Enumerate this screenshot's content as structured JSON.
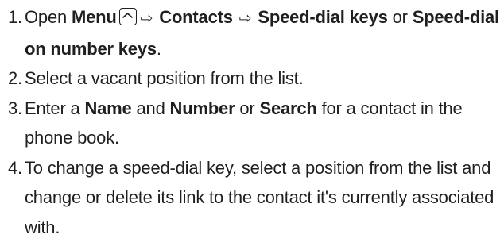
{
  "steps": [
    {
      "number": "1.",
      "open": "Open",
      "menu": "Menu",
      "menu_key_icon": "menu-key-icon",
      "arrow": "⇨",
      "contacts": "Contacts",
      "speed_dial_keys": "Speed-dial keys",
      "or": "or",
      "speed_dial_number_keys": "Speed-dial on number keys",
      "period": "."
    },
    {
      "number": "2.",
      "text": "Select a vacant position from the list."
    },
    {
      "number": "3.",
      "enter": "Enter a",
      "name": "Name",
      "and": "and",
      "number_label": "Number",
      "or": "or",
      "search": "Search",
      "rest": "for a contact in the phone book."
    },
    {
      "number": "4.",
      "text": "To change a speed-dial key, select a position from the list and change or delete its link to the contact it's currently associated with."
    }
  ]
}
